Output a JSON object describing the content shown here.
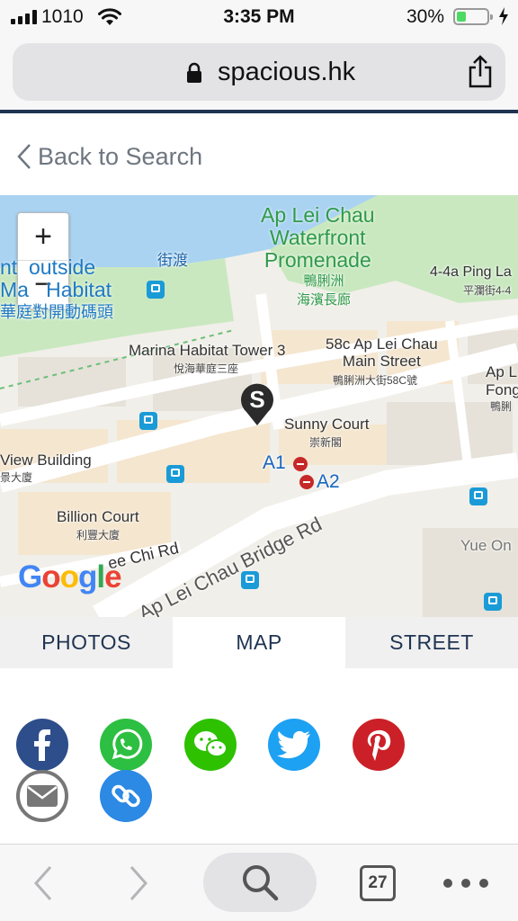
{
  "status_bar": {
    "carrier": "1010",
    "time": "3:35 PM",
    "battery_percent": "30%",
    "battery_level": 0.3,
    "icons": [
      "signal-icon",
      "wifi-icon",
      "battery-icon",
      "charging-icon"
    ]
  },
  "browser": {
    "url": "spacious.hk",
    "icons": [
      "lock-icon",
      "share-icon"
    ],
    "accent": "#1f3352"
  },
  "page": {
    "back_label": "Back to Search"
  },
  "map": {
    "labels": {
      "waterfront_1": "Ap Lei Chau",
      "waterfront_2": "Waterfront",
      "waterfront_3": "Promenade",
      "waterfront_zh_1": "鴨脷洲",
      "waterfront_zh_2": "海濱長廊",
      "ferry_zh": "街渡",
      "pier_1": "nt",
      "pier_1b": "outside",
      "pier_2": "Ma",
      "pier_2b": "Habitat",
      "pier_zh": "華庭對開動碼頭",
      "ping_lan": "4-4a Ping La",
      "ping_lan_zh": "平瀾街4-4",
      "marina_tower": "Marina Habitat Tower 3",
      "marina_tower_zh": "悅海華庭三座",
      "main_street_1": "58c Ap Lei Chau",
      "main_street_2": "Main Street",
      "main_street_zh": "鴨脷洲大街58C號",
      "ap_lei_1": "Ap L",
      "ap_lei_2": "Fong",
      "ap_lei_zh": "鴨脷",
      "sunny_court": "Sunny Court",
      "sunny_court_zh": "崇新閣",
      "view_building": "View Building",
      "view_building_zh": "景大廈",
      "billion_court": "Billion Court",
      "billion_court_zh": "利豐大廈",
      "station_a1": "A1",
      "station_a2": "A2",
      "yue_on": "Yue On",
      "road_chi": "ee Chi Rd",
      "road_bridge": "Ap Lei Chau Bridge Rd"
    },
    "zoom_in": "+",
    "zoom_out": "−",
    "google": [
      "G",
      "o",
      "o",
      "g",
      "l",
      "e"
    ],
    "google_colors": [
      "#4285F4",
      "#EA4335",
      "#FBBC05",
      "#4285F4",
      "#34A853",
      "#EA4335"
    ]
  },
  "tabs": [
    {
      "label": "PHOTOS",
      "active": false
    },
    {
      "label": "MAP",
      "active": true
    },
    {
      "label": "STREET",
      "active": false
    }
  ],
  "share": [
    {
      "name": "facebook",
      "color": "#2d4e8a"
    },
    {
      "name": "whatsapp",
      "color": "#2dbf41"
    },
    {
      "name": "wechat",
      "color": "#2dc100"
    },
    {
      "name": "twitter",
      "color": "#1da1f2"
    },
    {
      "name": "pinterest",
      "color": "#cb2027"
    },
    {
      "name": "email",
      "color": "#777777"
    },
    {
      "name": "copy-link",
      "color": "#2c89e4"
    }
  ],
  "toolbar": {
    "tab_count": "27",
    "icons": [
      "back-icon",
      "forward-icon",
      "search-icon",
      "tabs-icon",
      "more-icon"
    ]
  }
}
